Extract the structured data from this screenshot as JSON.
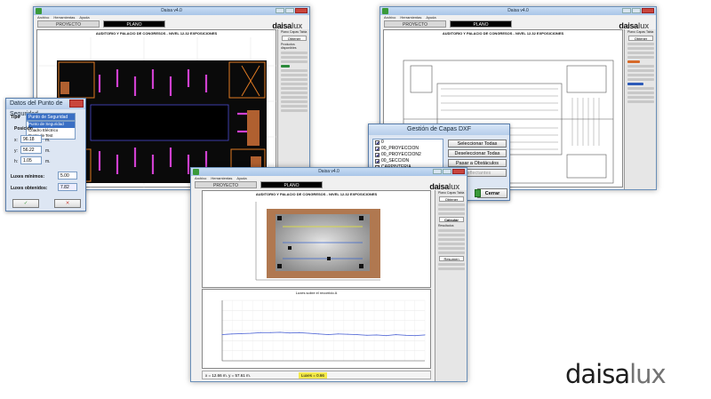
{
  "app": {
    "window_title": "Daisa v4.0",
    "menu": [
      "Archivo",
      "Herramientas",
      "Ayuda"
    ],
    "tabs": [
      "PROYECTO",
      "PLANO"
    ],
    "brand_dark": "daisa",
    "brand_light": "lux",
    "drawing_title": "AUDITORIO Y PALACIO DE CONGRESOS - NIVEL 12.32 EXPOSICIONES"
  },
  "side_panel": {
    "tabs_label": "Plano  Capas  Tabla",
    "buttons": [
      "Obtener",
      "Calcular",
      "Resumen"
    ],
    "labels": [
      "Productos disponibles",
      "Etiquetas",
      "Resultados",
      "Iluminación",
      "Línea de corte"
    ]
  },
  "dialog_punto": {
    "title": "Datos del Punto de Seguridad",
    "tipo_label": "Tipo",
    "tipo_value": "Punto de Seguridad",
    "options": [
      "Punto de Seguridad",
      "Cuadro Eléctrico",
      "Punto de Test"
    ],
    "posicion_label": "Posición",
    "x_label": "x:",
    "x_value": "96.18",
    "y_label": "y:",
    "y_value": "56.22",
    "h_label": "h:",
    "h_value": "1.05",
    "unit": "m.",
    "lux_min_label": "Luxes mínimos:",
    "lux_min_value": "5.00",
    "lux_obt_label": "Luxes obtenidos:",
    "lux_obt_value": "7.82",
    "ok_glyph": "✓",
    "cancel_glyph": "✕"
  },
  "dialog_capas": {
    "title": "Gestión de Capas DXF",
    "layers": [
      "0",
      "00_PROYECCION",
      "00_PROYECCION2",
      "00_SECCION",
      "CARPINTERIA"
    ],
    "buttons": [
      "Seleccionar Todas",
      "Deseleccionar Todas",
      "Pasar a Obstáculos",
      "Reflectantes"
    ],
    "close_label": "Cerrar"
  },
  "chart_panel": {
    "title": "Luxes sobre el recorrido A",
    "footer_left": "x = 12.66 m.    y = 57.61 m.",
    "footer_mid": "Luxes = 0.66",
    "chart_data": {
      "type": "line",
      "series": [
        {
          "values": [
            0.78,
            0.8,
            0.81,
            0.82,
            0.84,
            0.84,
            0.85,
            0.83,
            0.84,
            0.82,
            0.8,
            0.78,
            0.8,
            0.79,
            0.78,
            0.76,
            0.77,
            0.75,
            0.78,
            0.76,
            0.75,
            0.77
          ]
        }
      ],
      "ylim": [
        0,
        1.8
      ],
      "grid": true
    }
  },
  "logo": {
    "dark": "daisa",
    "light": "lux"
  }
}
